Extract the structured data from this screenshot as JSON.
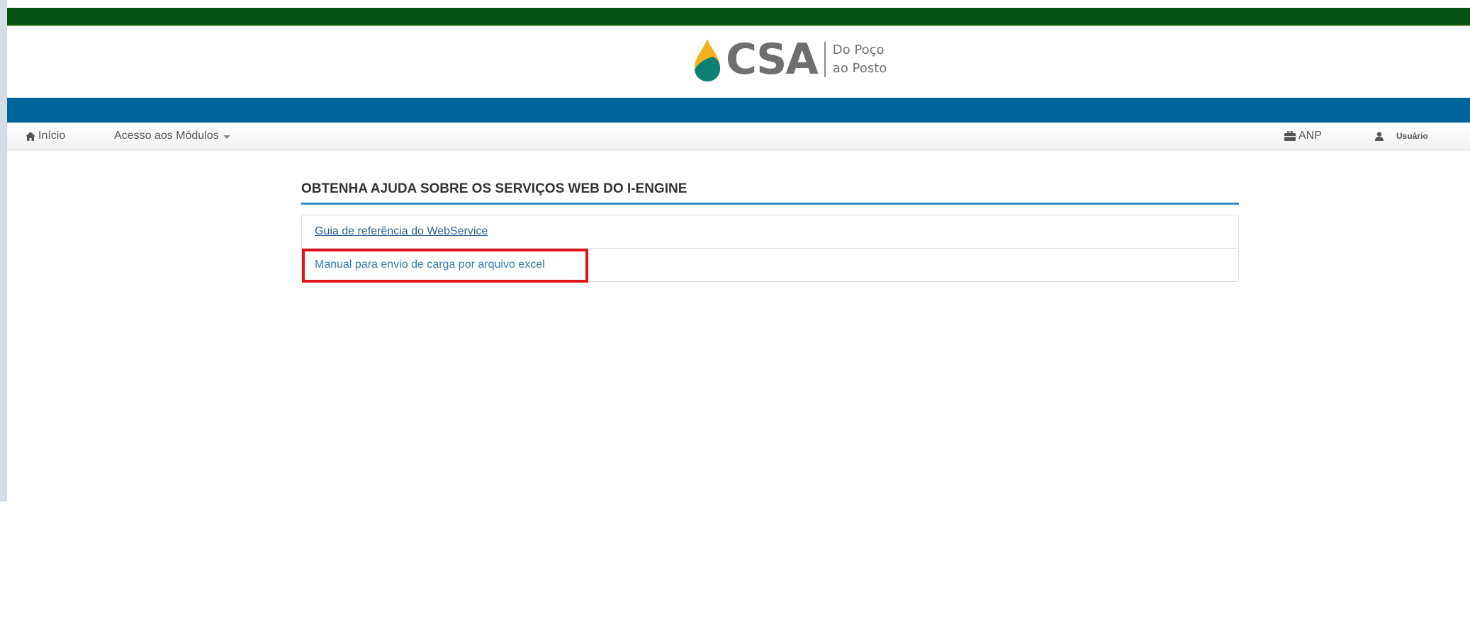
{
  "brand": {
    "logo_text": "CSA",
    "slogan_line1": "Do Poço",
    "slogan_line2": "ao Posto"
  },
  "navbar": {
    "home_label": "Início",
    "modules_label": "Acesso aos Módulos",
    "org_label": "ANP",
    "user_label": "Usuário"
  },
  "main": {
    "title": "OBTENHA AJUDA SOBRE OS SERVIÇOS WEB DO I-ENGINE",
    "links": [
      {
        "label": "Guia de referência do WebService"
      },
      {
        "label": "Manual para envio de carga por arquivo excel",
        "highlighted": true
      }
    ]
  },
  "colors": {
    "top_bar": "#045214",
    "blue_band": "#00659a",
    "title_underline": "#2b8fc4",
    "link": "#337ab7",
    "highlight_box": "#e0151b",
    "logo_drop_yellow": "#f2b01e",
    "logo_drop_teal": "#0b7f74"
  },
  "icons": {
    "home": "home-icon",
    "modules_dropdown": "caret-down-icon",
    "org": "briefcase-icon",
    "user": "user-icon"
  }
}
